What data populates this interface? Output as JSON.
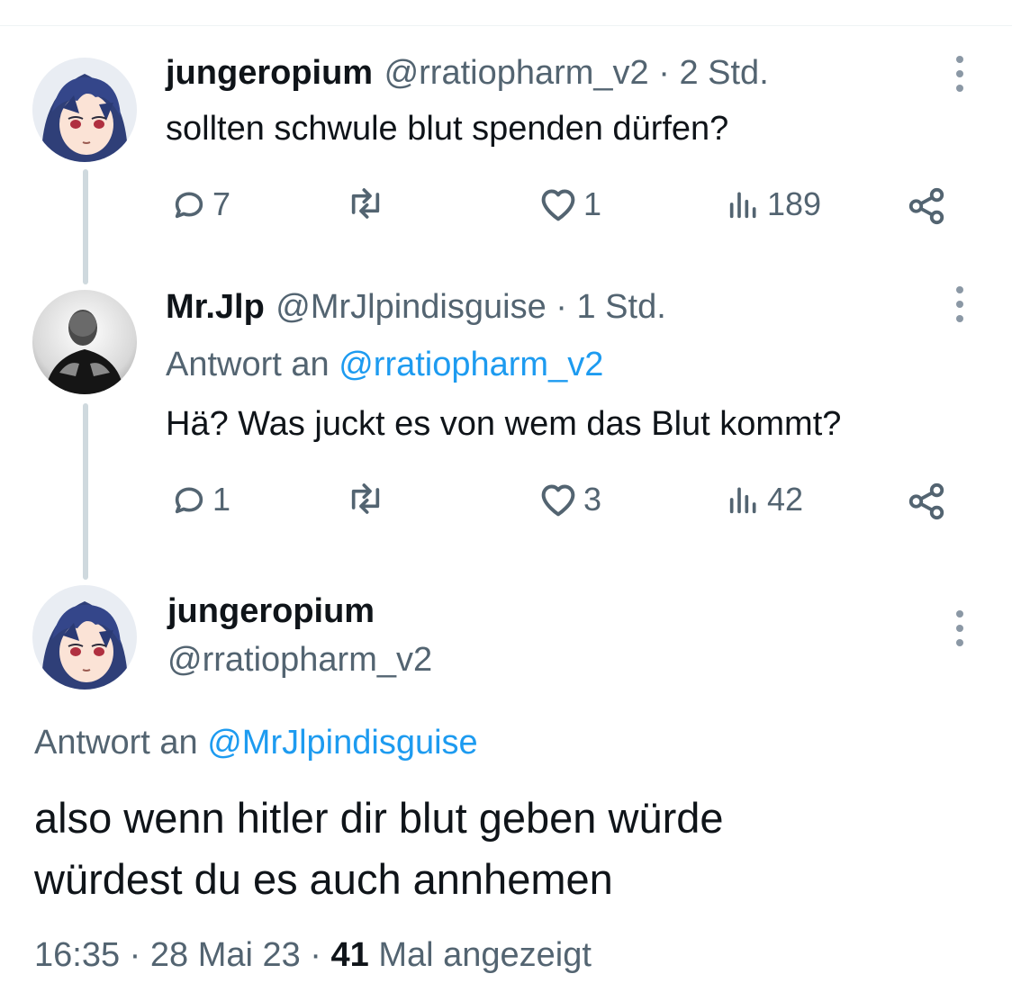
{
  "tweet1": {
    "display_name": "jungeropium",
    "handle_time": "@rratiopharm_v2 · 2 Std.",
    "text": "sollten schwule blut spenden dürfen?",
    "replies": "7",
    "likes": "1",
    "views": "189"
  },
  "tweet2": {
    "display_name": "Mr.Jlp",
    "handle_time": "@MrJlpindisguise · 1 Std.",
    "reply_prefix": "Antwort an ",
    "reply_to": "@rratiopharm_v2",
    "text": "Hä? Was juckt  es von wem das Blut kommt?",
    "replies": "1",
    "likes": "3",
    "views": "42"
  },
  "tweet3": {
    "display_name": "jungeropium",
    "handle": "@rratiopharm_v2",
    "reply_prefix": "Antwort an ",
    "reply_to": "@MrJlpindisguise",
    "text_line1": "also wenn hitler dir blut geben würde",
    "text_line2": "würdest du es auch annhemen",
    "timestamp": "16:35 · 28 Mai 23 · ",
    "view_count": "41",
    "view_suffix": " Mal angezeigt"
  },
  "icons": {
    "reply": "reply-bubble-icon",
    "retweet": "retweet-icon",
    "like": "heart-icon",
    "views": "views-bar-icon",
    "share": "share-icon",
    "more": "more-vertical-icon"
  },
  "colors": {
    "text": "#0f1419",
    "secondary": "#536471",
    "link": "#1d9bf0",
    "thread_line": "#cfd9de"
  }
}
